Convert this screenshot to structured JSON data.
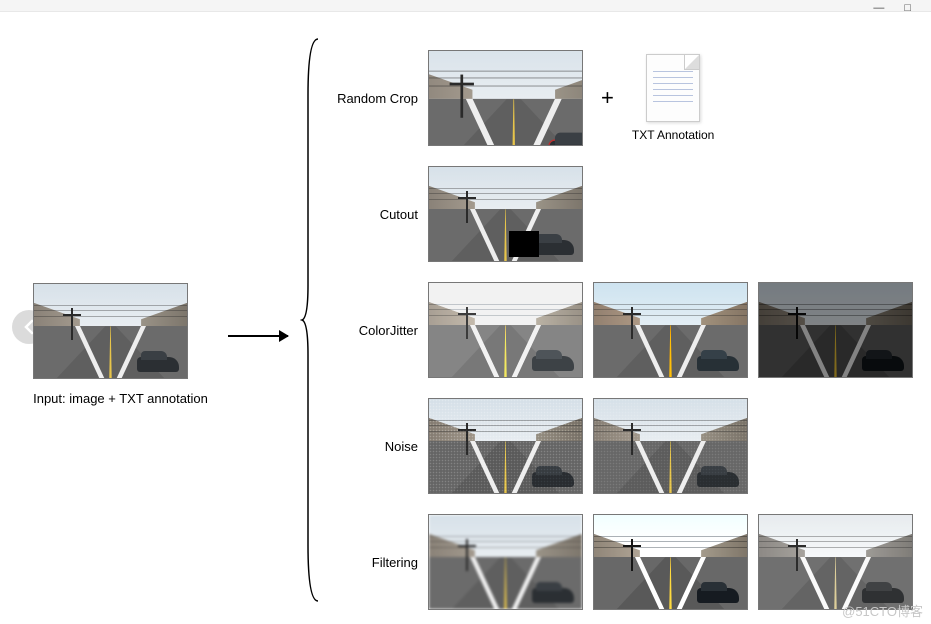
{
  "watermark": "@51CTO博客",
  "window": {
    "minimize": "—",
    "maximize": "□"
  },
  "input": {
    "caption": "Input: image + TXT annotation"
  },
  "plus_symbol": "+",
  "txt_annotation_label": "TXT Annotation",
  "rows": [
    {
      "label": "Random Crop",
      "variants": [
        "v-crop"
      ],
      "show_txt": true
    },
    {
      "label": "Cutout",
      "variants": [
        "v-cutout"
      ],
      "show_txt": false
    },
    {
      "label": "ColorJitter",
      "variants": [
        "v-bright",
        "v-sat",
        "v-dark"
      ],
      "show_txt": false
    },
    {
      "label": "Noise",
      "variants": [
        "v-noise",
        "v-noise v-noise2"
      ],
      "show_txt": false
    },
    {
      "label": "Filtering",
      "variants": [
        "v-blur",
        "v-sharp",
        "v-gray"
      ],
      "show_txt": false
    }
  ]
}
